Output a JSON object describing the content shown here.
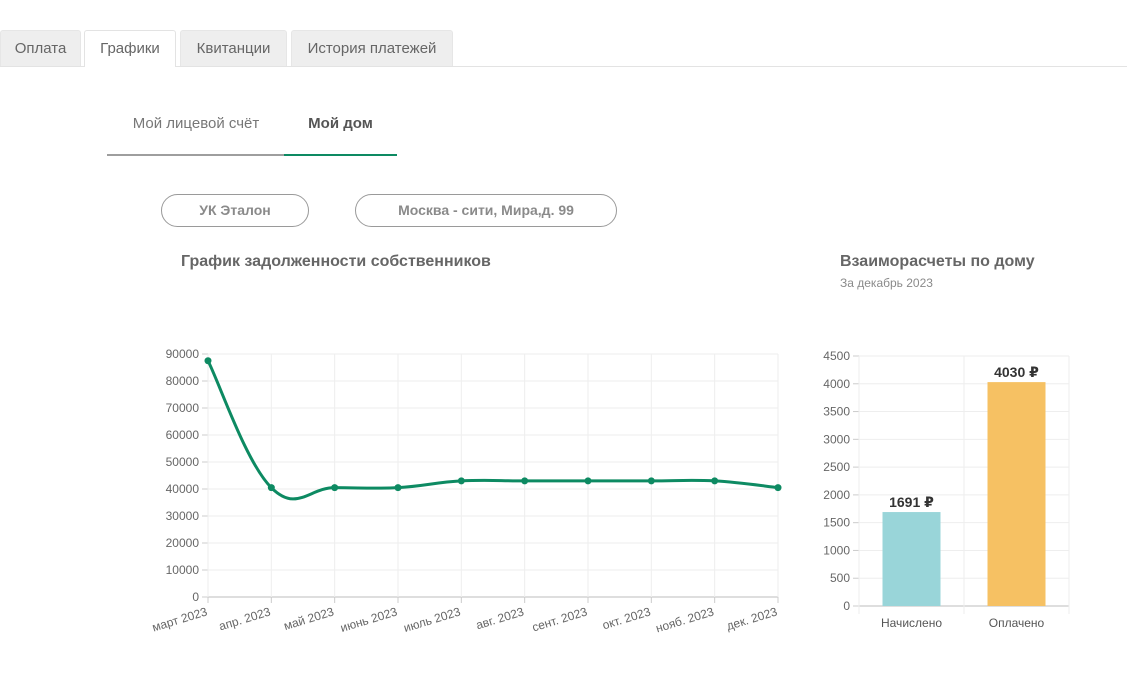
{
  "top_tabs": [
    {
      "label": "Оплата"
    },
    {
      "label": "Графики"
    },
    {
      "label": "Квитанции"
    },
    {
      "label": "История платежей"
    }
  ],
  "sub_tabs": [
    {
      "label": "Мой лицевой счёт"
    },
    {
      "label": "Мой дом"
    }
  ],
  "filters": {
    "company": "УК Эталон",
    "address": "Москва - сити, Мира,д. 99"
  },
  "colors": {
    "accent": "#0d8a62",
    "bar_accrued": "#99d5d9",
    "bar_paid": "#f6c163"
  },
  "chart_data": [
    {
      "type": "line",
      "title": "График задолженности собственников",
      "categories": [
        "март 2023",
        "апр. 2023",
        "май 2023",
        "июнь 2023",
        "июль 2023",
        "авг. 2023",
        "сент. 2023",
        "окт. 2023",
        "нояб. 2023",
        "дек. 2023"
      ],
      "series": [
        {
          "values": [
            87500,
            40500,
            40500,
            40500,
            43000,
            43000,
            43000,
            43000,
            43000,
            40500
          ]
        }
      ],
      "ylim": [
        0,
        90000
      ],
      "yticks": [
        "0",
        "10000",
        "20000",
        "30000",
        "40000",
        "50000",
        "60000",
        "70000",
        "80000",
        "90000"
      ],
      "grid": true
    },
    {
      "type": "bar",
      "title": "Взаиморасчеты по дому",
      "subtitle": "За декабрь 2023",
      "categories": [
        "Начислено",
        "Оплачено"
      ],
      "values": [
        1691,
        4030
      ],
      "value_labels": [
        "1691 ₽",
        "4030 ₽"
      ],
      "ylim": [
        0,
        4500
      ],
      "yticks": [
        "0",
        "500",
        "1000",
        "1500",
        "2000",
        "2500",
        "3000",
        "3500",
        "4000",
        "4500"
      ],
      "grid": true
    }
  ]
}
